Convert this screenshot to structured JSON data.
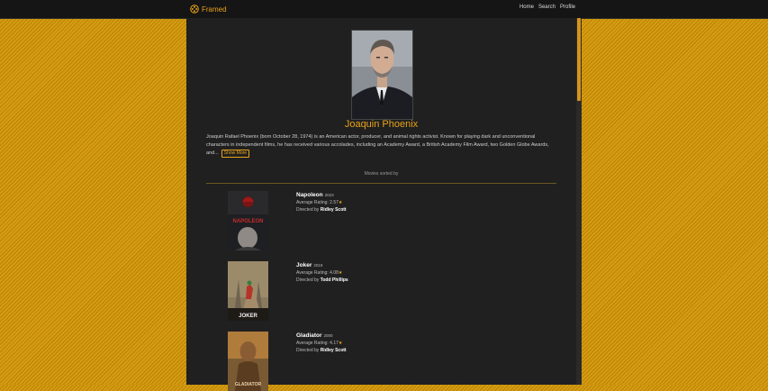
{
  "brand": {
    "name": "Framed",
    "icon": "film-reel-icon"
  },
  "nav": {
    "home": "Home",
    "search": "Search",
    "profile": "Profile"
  },
  "person": {
    "name": "Joaquin Phoenix",
    "bio": "Joaquin Rafael Phoenix (born October 28, 1974) is an American actor, producer, and animal rights activist. Known for playing dark and unconventional characters in independent films, he has received various accolades, including an Academy Award, a British Academy Film Award, two Golden Globe Awards, and...",
    "show_more": "Show More"
  },
  "sort_label": "Movies sorted by",
  "movies": [
    {
      "title": "Napoleon",
      "year": "2023",
      "rating_label": "Average Rating:",
      "rating": "2.57",
      "director_label": "Directed by",
      "director": "Ridley Scott",
      "poster_text": "NAPOLEON"
    },
    {
      "title": "Joker",
      "year": "2019",
      "rating_label": "Average Rating:",
      "rating": "4.08",
      "director_label": "Directed by",
      "director": "Todd Phillips",
      "poster_text": "JOKER"
    },
    {
      "title": "Gladiator",
      "year": "2000",
      "rating_label": "Average Rating:",
      "rating": "4.17",
      "director_label": "Directed by",
      "director": "Ridley Scott",
      "poster_text": "GLADIATOR"
    }
  ],
  "colors": {
    "accent": "#e8a317",
    "page_bg": "#202020",
    "topbar": "#151515"
  }
}
